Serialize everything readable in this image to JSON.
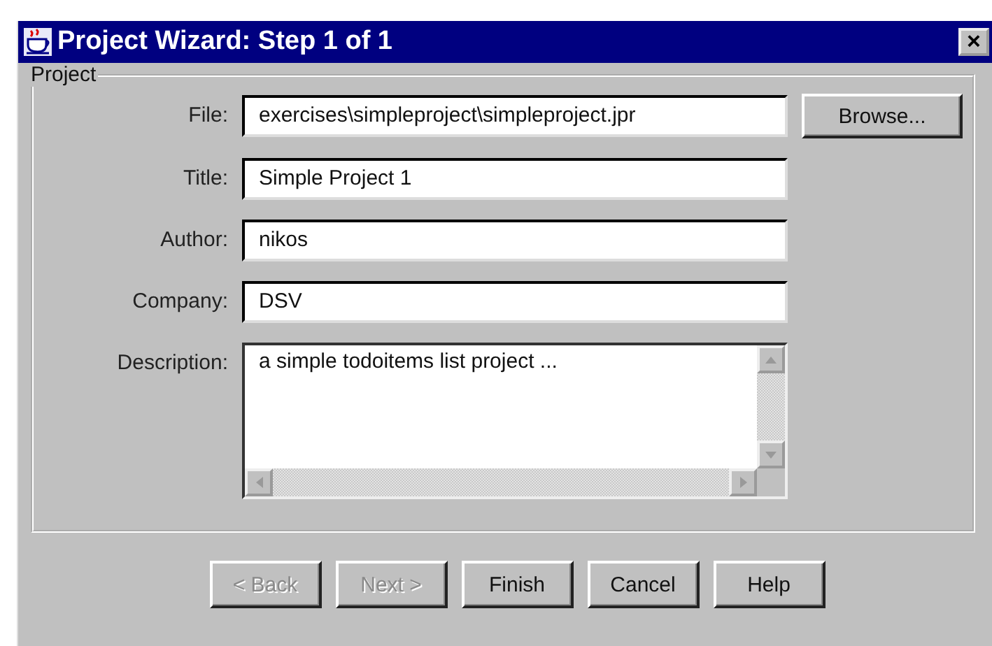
{
  "window": {
    "title": "Project Wizard: Step 1 of 1",
    "close": "×"
  },
  "group": {
    "title": "Project"
  },
  "fields": [
    {
      "label": "File:",
      "kind": "text",
      "value": "exercises\\simpleproject\\simpleproject.jpr",
      "button": "Browse..."
    },
    {
      "label": "Title:",
      "kind": "text",
      "value": "Simple Project 1"
    },
    {
      "label": "Author:",
      "kind": "text",
      "value": "nikos"
    },
    {
      "label": "Company:",
      "kind": "text",
      "value": "DSV"
    },
    {
      "label": "Description:",
      "kind": "textarea",
      "value": "a simple todoitems list project ..."
    }
  ],
  "buttons": [
    {
      "label": "< Back",
      "disabled": true
    },
    {
      "label": "Next >",
      "disabled": true
    },
    {
      "label": "Finish",
      "disabled": false
    },
    {
      "label": "Cancel",
      "disabled": false
    },
    {
      "label": "Help",
      "disabled": false
    }
  ]
}
